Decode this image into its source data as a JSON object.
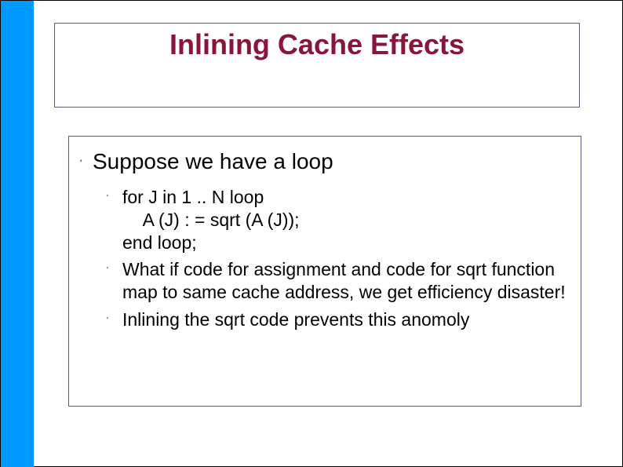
{
  "title": "Inlining Cache Effects",
  "main_bullet": "Suppose we have a loop",
  "sub_bullets": {
    "b0": "for J in 1 .. N loop\n    A (J) : = sqrt (A (J));\nend loop;",
    "b1": "What if code for assignment and code for sqrt function map to same cache address, we get efficiency disaster!",
    "b2": "Inlining the sqrt code prevents this anomoly"
  },
  "bullet_mark_main": "'",
  "bullet_mark_sub": "'"
}
